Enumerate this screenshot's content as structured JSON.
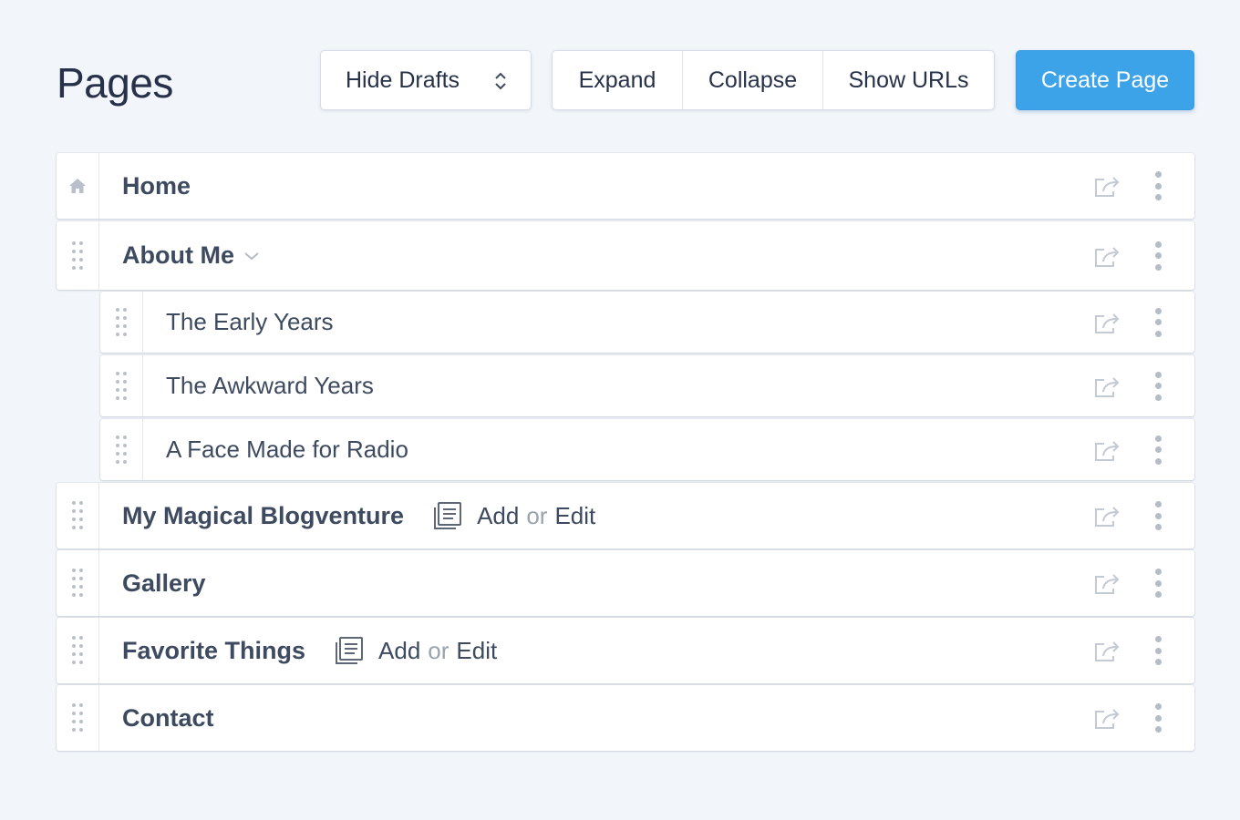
{
  "header": {
    "title": "Pages",
    "hide_drafts_label": "Hide Drafts",
    "expand_label": "Expand",
    "collapse_label": "Collapse",
    "show_urls_label": "Show URLs",
    "create_label": "Create Page"
  },
  "pages": {
    "home": {
      "title": "Home"
    },
    "about": {
      "title": "About Me"
    },
    "early": {
      "title": "The Early Years"
    },
    "awkward": {
      "title": "The Awkward Years"
    },
    "radio": {
      "title": "A Face Made for Radio"
    },
    "blog": {
      "title": "My Magical Blogventure",
      "add": "Add",
      "or": "or",
      "edit": "Edit"
    },
    "gallery": {
      "title": "Gallery"
    },
    "favorites": {
      "title": "Favorite Things",
      "add": "Add",
      "or": "or",
      "edit": "Edit"
    },
    "contact": {
      "title": "Contact"
    }
  },
  "colors": {
    "accent": "#3da3e9",
    "background": "#f2f5fa",
    "text": "#3d4a5f"
  }
}
